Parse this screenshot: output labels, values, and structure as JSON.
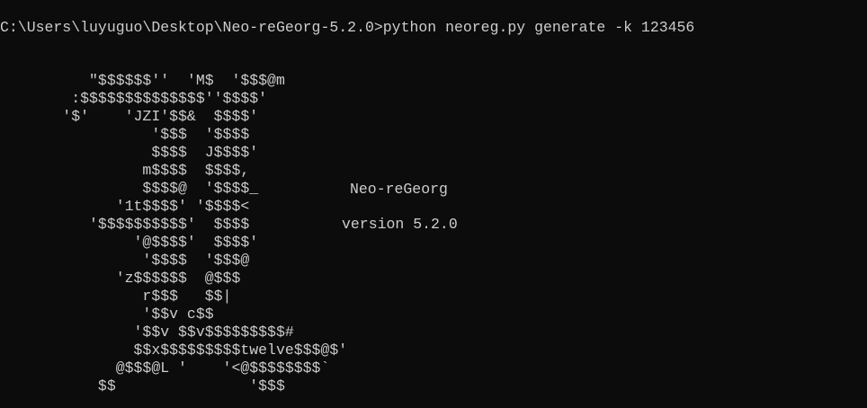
{
  "terminal": {
    "command_line": "C:\\Users\\luyuguo\\Desktop\\Neo-reGeorg-5.2.0>python neoreg.py generate -k 123456",
    "banner_art": [
      "          \"$$$$$$''  'M$  '$$$@m",
      "        :$$$$$$$$$$$$$$''$$$$'",
      "       '$'    'JZI'$$&  $$$$'",
      "                 '$$$  '$$$$",
      "                 $$$$  J$$$$'",
      "                m$$$$  $$$$,",
      "                $$$$@  '$$$$_",
      "             '1t$$$$' '$$$$<",
      "          '$$$$$$$$$$'  $$$$",
      "               '@$$$$'  $$$$'",
      "                '$$$$  '$$$@",
      "             'z$$$$$$  @$$$",
      "                r$$$   $$|",
      "                '$$v c$$",
      "               '$$v $$v$$$$$$$$$#",
      "               $$x$$$$$$$$$twelve$$$@$'",
      "             @$$$@L '    '<@$$$$$$$$`",
      "           $$               '$$$"
    ],
    "tool_name": "Neo-reGeorg",
    "version_text": "version 5.2.0"
  }
}
